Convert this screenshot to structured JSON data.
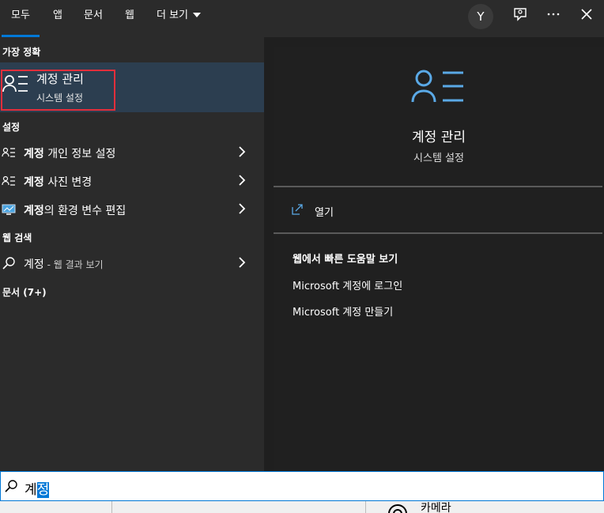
{
  "tabs": [
    {
      "label": "모두",
      "active": true
    },
    {
      "label": "앱"
    },
    {
      "label": "문서"
    },
    {
      "label": "웹"
    },
    {
      "label": "더 보기"
    }
  ],
  "header": {
    "avatar_initial": "Y"
  },
  "left": {
    "best_match_header": "가장 정확",
    "best_match": {
      "title": "계정 관리",
      "subtitle": "시스템 설정"
    },
    "settings_header": "설정",
    "settings_items": [
      {
        "bold": "계정",
        "rest": " 개인 정보 설정",
        "icon": "account-list-icon"
      },
      {
        "bold": "계정",
        "rest": " 사진 변경",
        "icon": "account-list-icon"
      },
      {
        "bold": "계정",
        "rest": "의 환경 변수 편집",
        "icon": "monitor-icon"
      }
    ],
    "web_header": "웹 검색",
    "web_item": {
      "query": "계정",
      "suffix": " - 웹 결과 보기"
    },
    "docs_header": "문서 (7+)"
  },
  "right": {
    "title": "계정 관리",
    "subtitle": "시스템 설정",
    "open_label": "열기",
    "web_help_header": "웹에서 빠른 도움말 보기",
    "web_links": [
      "Microsoft 계정에 로그인",
      "Microsoft 계정 만들기"
    ]
  },
  "search": {
    "typed": "계",
    "selected": "정"
  },
  "taskbar": {
    "camera_label": "카메라"
  },
  "colors": {
    "accent": "#0078d7",
    "highlight_border": "#e22e3b",
    "selected_bg": "#2c3e50"
  }
}
